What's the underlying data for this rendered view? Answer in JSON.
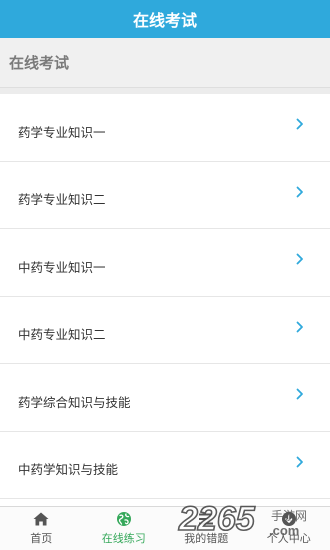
{
  "header": {
    "title": "在线考试"
  },
  "section": {
    "title": "在线考试"
  },
  "items": [
    {
      "label": "药学专业知识一"
    },
    {
      "label": "药学专业知识二"
    },
    {
      "label": "中药专业知识一"
    },
    {
      "label": "中药专业知识二"
    },
    {
      "label": "药学综合知识与技能"
    },
    {
      "label": "中药学知识与技能"
    }
  ],
  "tabs": [
    {
      "label": "首页",
      "icon": "home-icon"
    },
    {
      "label": "在线练习",
      "icon": "globe-icon",
      "active": true
    },
    {
      "label": "我的错题",
      "icon": "list-icon"
    },
    {
      "label": "个人中心",
      "icon": "download-icon"
    }
  ],
  "watermark": {
    "text": "2265.com",
    "sub": "手游网"
  },
  "colors": {
    "accent": "#2fa9dc",
    "active_tab": "#35a85a"
  }
}
